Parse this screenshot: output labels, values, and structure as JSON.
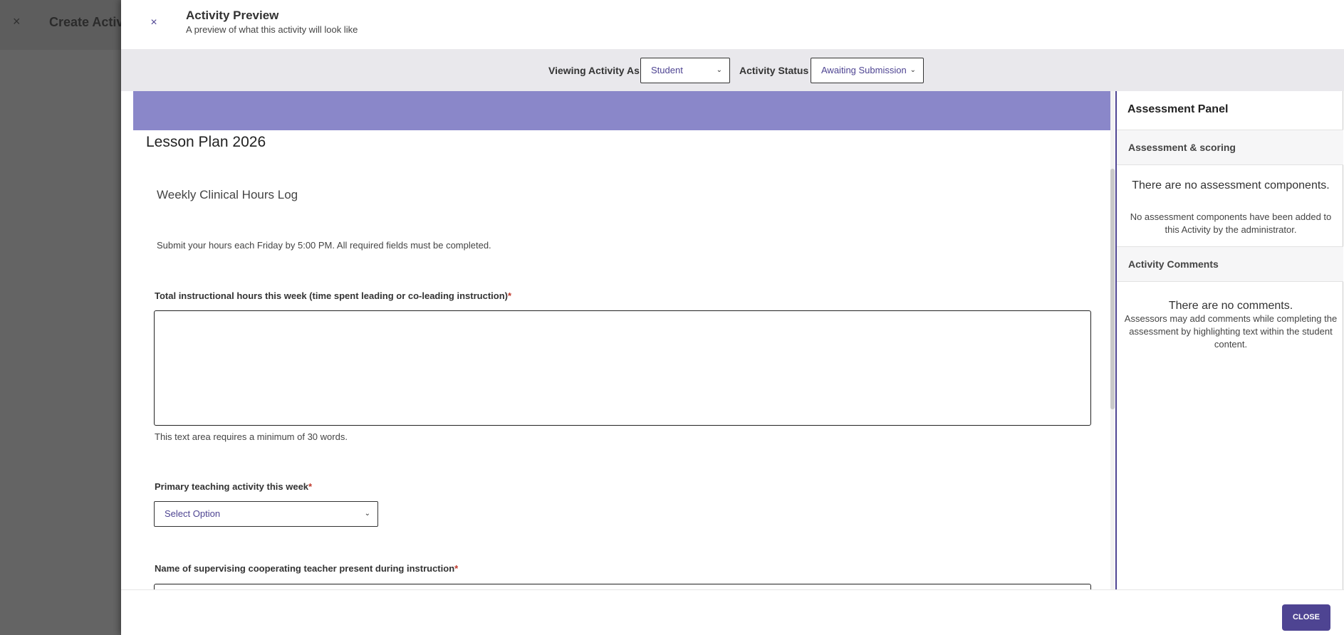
{
  "background": {
    "close_icon": "×",
    "title": "Create Activi"
  },
  "drawer": {
    "close_icon": "×",
    "title": "Activity Preview",
    "subtitle": "A preview of what this activity will look like"
  },
  "toolbar": {
    "viewing_as_label": "Viewing Activity As",
    "viewing_as_value": "Student",
    "status_label": "Activity Status",
    "status_value": "Awaiting Submission",
    "chevron": "⌄"
  },
  "content": {
    "banner_color": "#8a87c9",
    "lesson_title": "Lesson Plan 2026",
    "section_title": "Weekly Clinical Hours Log",
    "instructions": "Submit your hours each Friday by 5:00 PM. All required fields must be completed.",
    "fields": [
      {
        "label": "Total instructional hours this week (time spent leading or co-leading instruction)",
        "required_mark": "*",
        "hint": "This text area requires a minimum of 30 words."
      },
      {
        "label": "Primary teaching activity this week",
        "required_mark": "*",
        "placeholder": "Select Option"
      },
      {
        "label": "Name of supervising cooperating teacher present during instruction",
        "required_mark": "*"
      }
    ]
  },
  "panel": {
    "title": "Assessment Panel",
    "assessment_header": "Assessment & scoring",
    "assessment_empty_title": "There are no assessment components.",
    "assessment_empty_text": "No assessment components have been added to this Activity by the administrator.",
    "comments_header": "Activity Comments",
    "comments_empty_title": "There are no comments.",
    "comments_empty_text": "Assessors may add comments while completing the assessment by highlighting text within the student content."
  },
  "footer": {
    "close_label": "CLOSE"
  },
  "colors": {
    "accent": "#4e4492",
    "banner": "#8a87c9",
    "required": "#c0392b"
  }
}
